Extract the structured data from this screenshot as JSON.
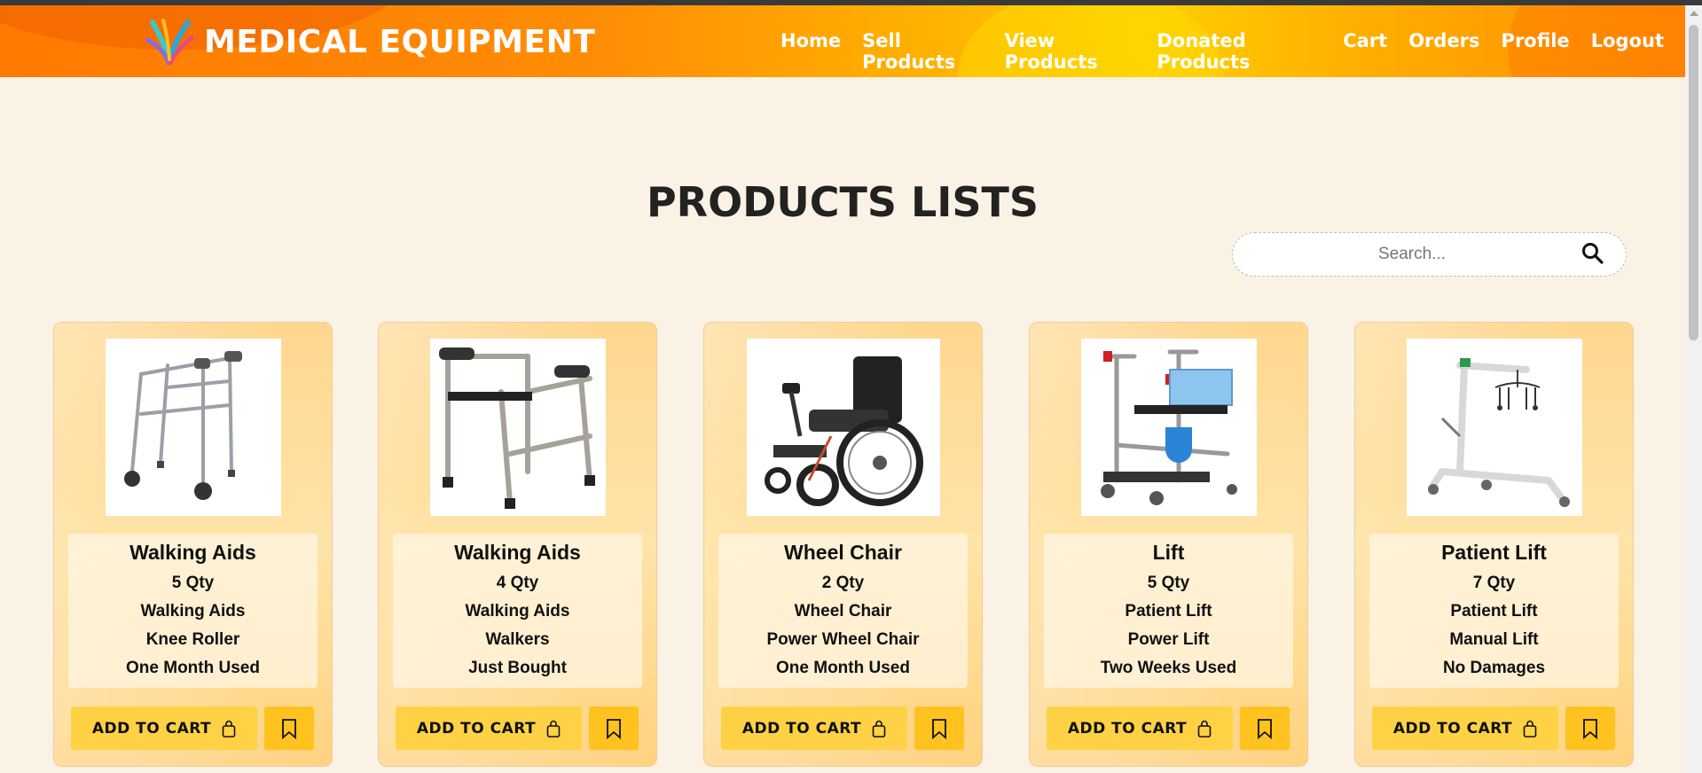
{
  "header": {
    "brand": "MEDICAL EQUIPMENT",
    "nav": [
      "Home",
      "Sell Products",
      "View Products",
      "Donated Products",
      "Cart",
      "Orders",
      "Profile",
      "Logout"
    ]
  },
  "page_title": "PRODUCTS LISTS",
  "search": {
    "placeholder": "Search..."
  },
  "add_to_cart_label": "ADD TO CART",
  "products": [
    {
      "name": "Walking Aids",
      "qty": "5 Qty",
      "category": "Walking Aids",
      "type": "Knee Roller",
      "condition": "One Month Used",
      "image": "walker-with-wheels"
    },
    {
      "name": "Walking Aids",
      "qty": "4 Qty",
      "category": "Walking Aids",
      "type": "Walkers",
      "condition": "Just Bought",
      "image": "walker"
    },
    {
      "name": "Wheel Chair",
      "qty": "2 Qty",
      "category": "Wheel Chair",
      "type": "Power Wheel Chair",
      "condition": "One Month Used",
      "image": "power-wheelchair"
    },
    {
      "name": "Lift",
      "qty": "5 Qty",
      "category": "Patient Lift",
      "type": "Power Lift",
      "condition": "Two Weeks Used",
      "image": "transfer-lift"
    },
    {
      "name": "Patient Lift",
      "qty": "7 Qty",
      "category": "Patient Lift",
      "type": "Manual Lift",
      "condition": "No Damages",
      "image": "hoyer-lift"
    }
  ]
}
